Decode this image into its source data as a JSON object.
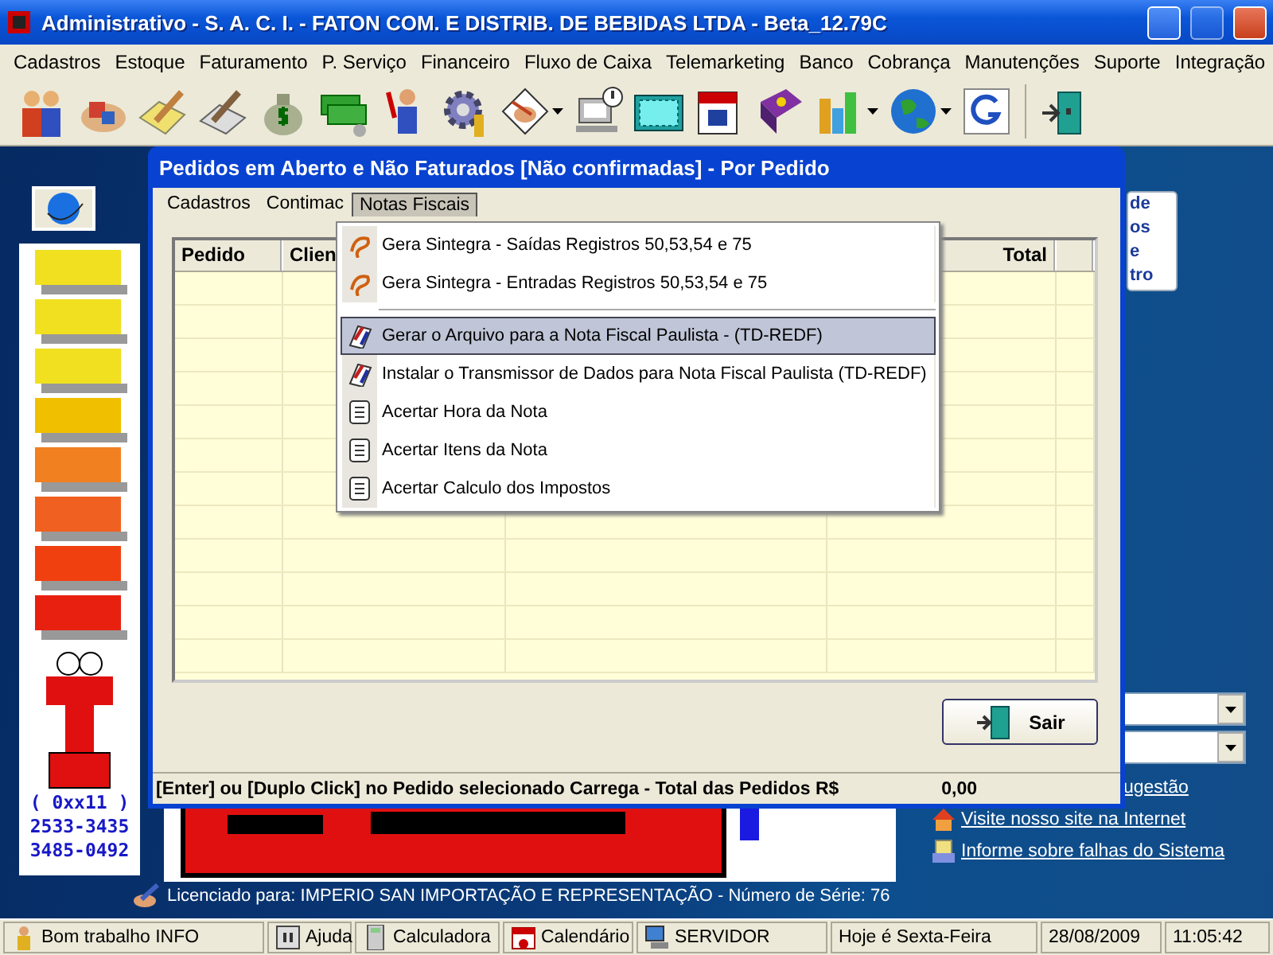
{
  "window": {
    "title": "Administrativo - S. A. C. I. - FATON COM. E DISTRIB. DE BEBIDAS LTDA - Beta_12.79C"
  },
  "menu_bar": [
    "Cadastros",
    "Estoque",
    "Faturamento",
    "P. Serviço",
    "Financeiro",
    "Fluxo de Caixa",
    "Telemarketing",
    "Banco",
    "Cobrança",
    "Manutenções",
    "Suporte",
    "Integração"
  ],
  "toolbar": [
    {
      "dropdown": false
    },
    {
      "dropdown": false
    },
    {
      "dropdown": false
    },
    {
      "dropdown": false
    },
    {
      "dropdown": false
    },
    {
      "dropdown": false
    },
    {
      "dropdown": false
    },
    {
      "dropdown": false
    },
    {
      "dropdown": true
    },
    {
      "dropdown": false
    },
    {
      "dropdown": false
    },
    {
      "dropdown": false
    },
    {
      "dropdown": false
    },
    {
      "dropdown": true
    },
    {
      "dropdown": true
    },
    {
      "dropdown": false
    },
    {
      "dropdown": false
    }
  ],
  "side_panel": {
    "phone_lines": [
      "( 0xx11 )",
      "2533-3435",
      "3485-0492"
    ]
  },
  "info_panel": {
    "lines": [
      "de",
      "os",
      "e",
      "tro"
    ]
  },
  "links": [
    {
      "text": "ugestão",
      "kind": "plain"
    },
    {
      "text": "Visite nosso site na Internet",
      "kind": "home"
    },
    {
      "text": "Informe sobre falhas do Sistema",
      "kind": "note"
    }
  ],
  "license": "Licenciado para: IMPERIO SAN IMPORTAÇÃO E REPRESENTAÇÃO - Número de Série: 76",
  "dialog": {
    "title": "Pedidos em Aberto e Não Faturados [Não confirmadas] - Por Pedido",
    "menu": [
      {
        "label": "Cadastros",
        "selected": false
      },
      {
        "label": "Contimac",
        "selected": false
      },
      {
        "label": "Notas Fiscais",
        "selected": true
      }
    ],
    "columns": [
      "Pedido",
      "Clien",
      "Total"
    ],
    "exit_button": "Sair",
    "footer_text": "[Enter] ou [Duplo Click] no Pedido selecionado Carrega - Total das Pedidos R$",
    "footer_total": "0,00"
  },
  "open_menu": {
    "items": [
      {
        "kind": "sintegra",
        "label": "Gera Sintegra - Saídas Registros 50,53,54 e 75",
        "selected": false
      },
      {
        "kind": "sintegra",
        "label": "Gera Sintegra - Entradas Registros 50,53,54 e 75",
        "selected": false
      },
      {
        "kind": "separator"
      },
      {
        "kind": "redf",
        "label": "Gerar o Arquivo para a Nota Fiscal Paulista - (TD-REDF)",
        "selected": true
      },
      {
        "kind": "redf",
        "label": "Instalar o Transmissor de Dados para Nota Fiscal Paulista (TD-REDF)",
        "selected": false
      },
      {
        "kind": "doc",
        "label": "Acertar Hora da Nota",
        "selected": false
      },
      {
        "kind": "doc",
        "label": "Acertar Itens da Nota",
        "selected": false
      },
      {
        "kind": "doc",
        "label": "Acertar Calculo dos Impostos",
        "selected": false
      }
    ]
  },
  "status_bar": [
    {
      "text": "Bom trabalho INFO",
      "kind": "person"
    },
    {
      "text": "Ajuda",
      "kind": "f1"
    },
    {
      "text": "Calculadora",
      "kind": "calculator"
    },
    {
      "text": "Calendário",
      "kind": "calendar"
    },
    {
      "text": "SERVIDOR",
      "kind": "computer"
    },
    {
      "text": "Hoje é Sexta-Feira",
      "kind": "plain"
    },
    {
      "text": "28/08/2009",
      "kind": "plain"
    },
    {
      "text": "11:05:42",
      "kind": "plain"
    }
  ]
}
